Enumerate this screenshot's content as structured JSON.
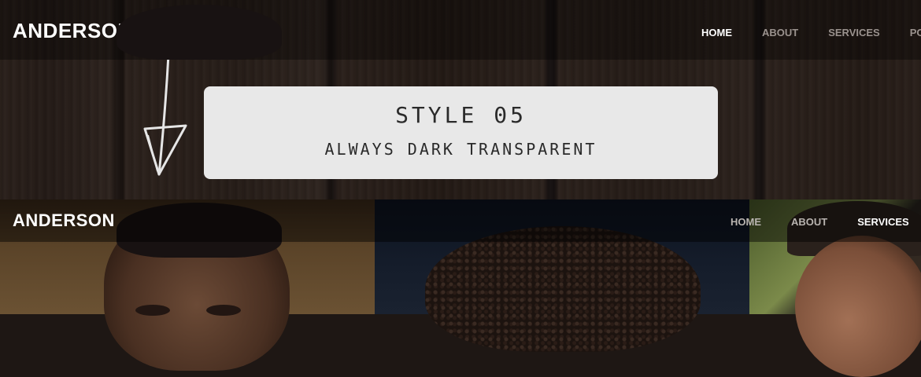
{
  "header": {
    "logo": "ANDERSON",
    "menu": [
      {
        "label": "HOME",
        "active": true
      },
      {
        "label": "ABOUT",
        "active": false
      },
      {
        "label": "SERVICES",
        "active": false
      },
      {
        "label": "PO",
        "active": false
      }
    ]
  },
  "label_card": {
    "title": "STYLE 05",
    "subtitle": "ALWAYS DARK TRANSPARENT"
  },
  "preview": {
    "logo": "ANDERSON",
    "menu": [
      {
        "label": "HOME",
        "active": false
      },
      {
        "label": "ABOUT",
        "active": false
      },
      {
        "label": "SERVICES",
        "active": true
      }
    ]
  },
  "icons": [
    "arrow-down-icon"
  ],
  "colors": {
    "card_bg": "#e8e8e8",
    "nav_active": "#ffffff",
    "nav_inactive": "#9a928e"
  }
}
